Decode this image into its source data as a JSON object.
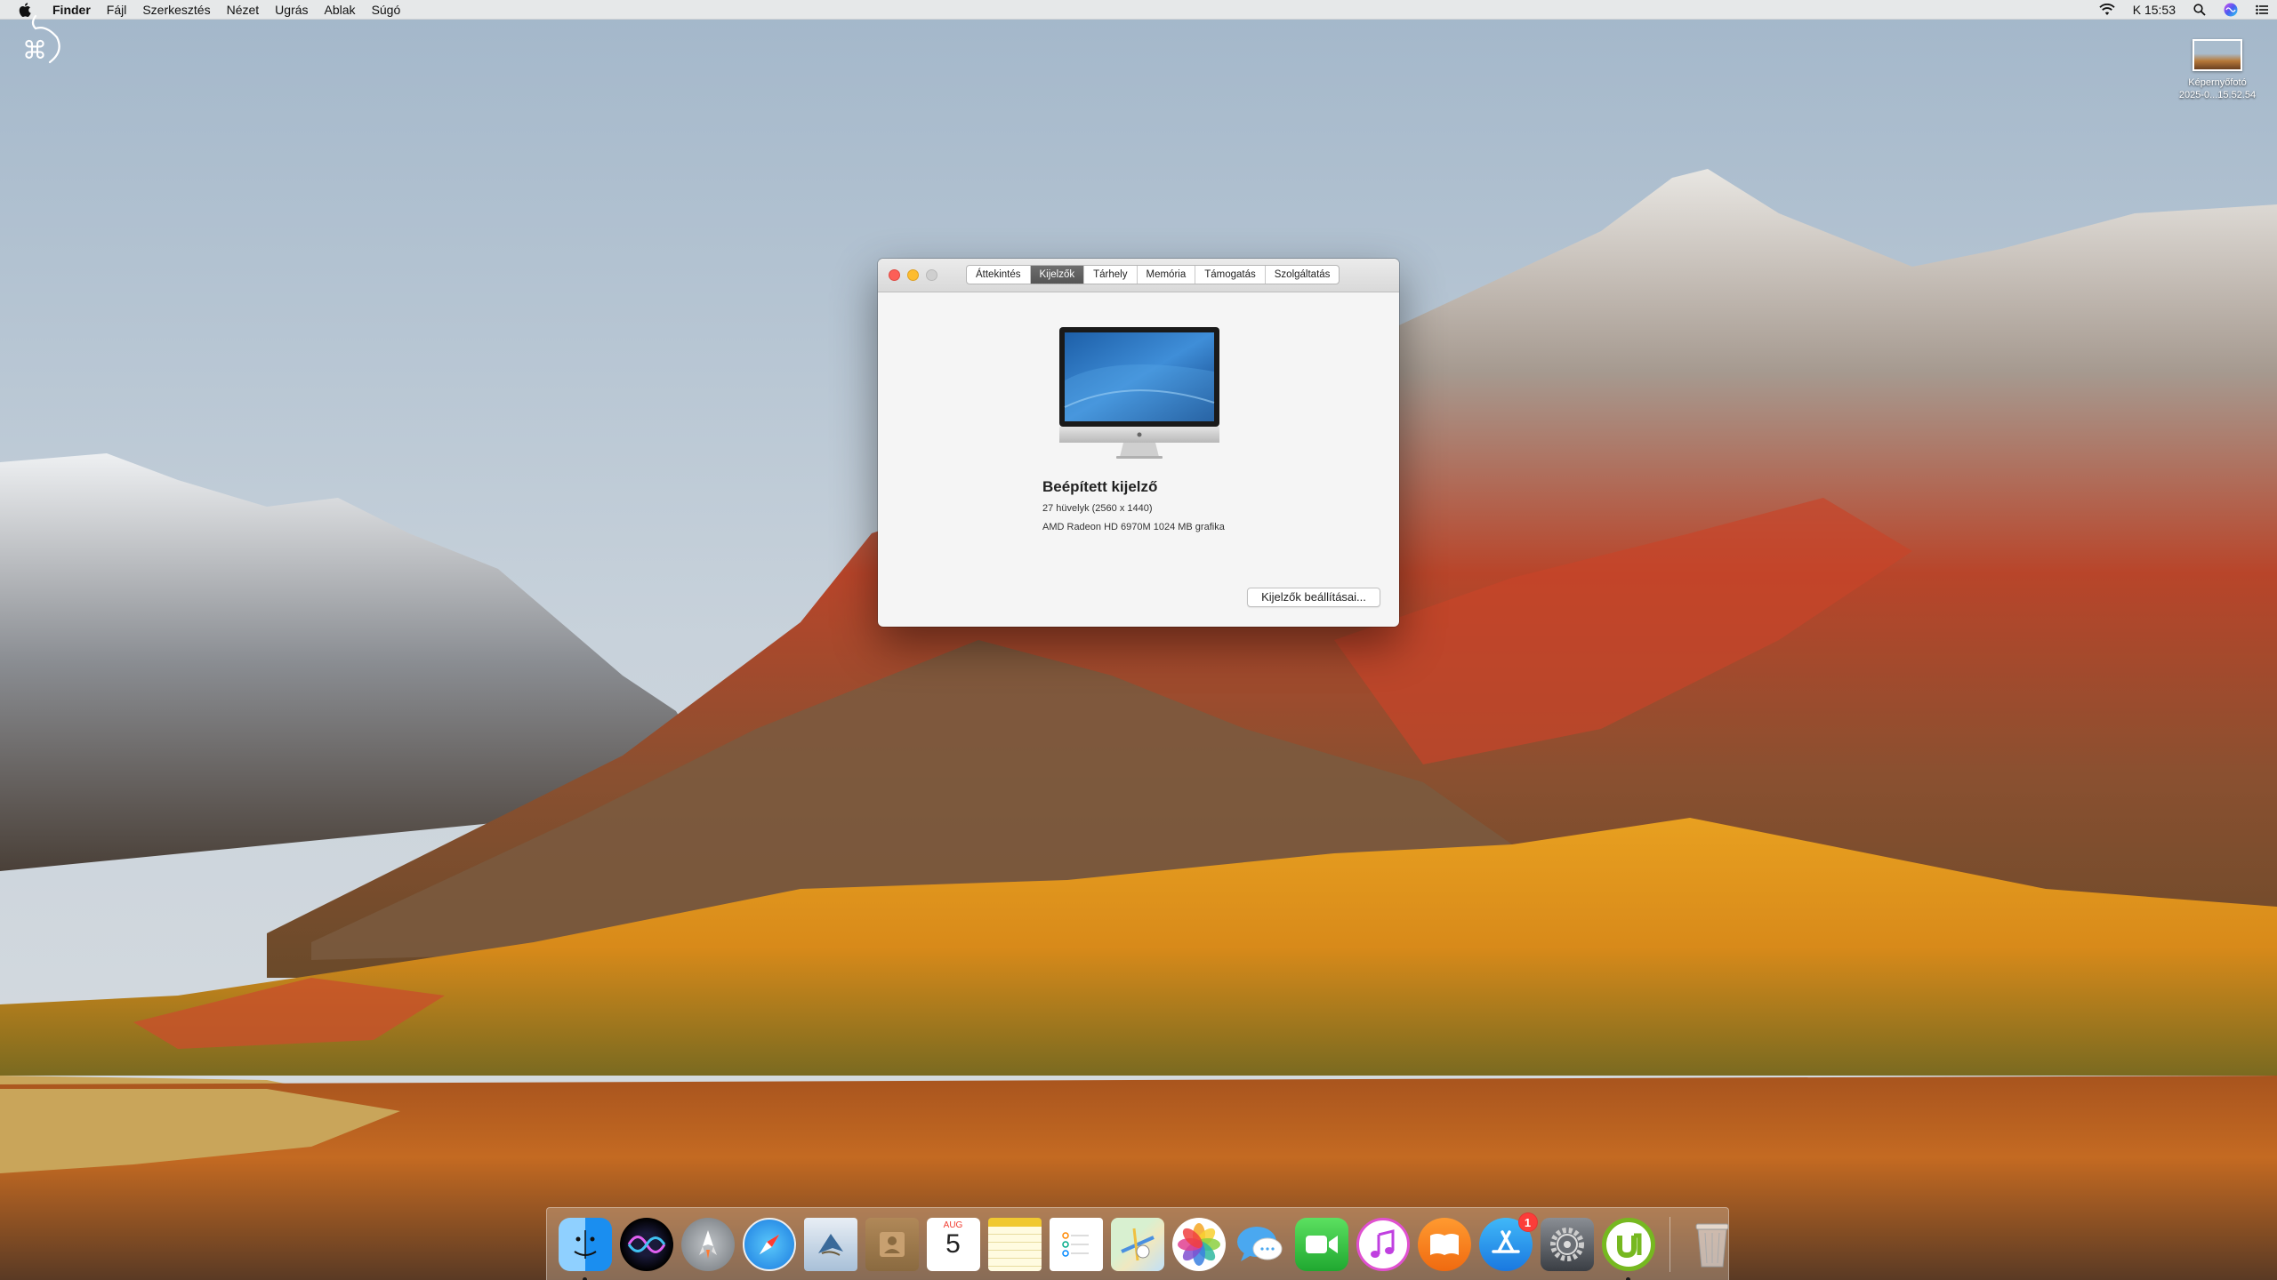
{
  "menubar": {
    "apple_icon": "apple-logo-icon",
    "app_name": "Finder",
    "menus": [
      "Fájl",
      "Szerkesztés",
      "Nézet",
      "Ugrás",
      "Ablak",
      "Súgó"
    ],
    "clock": "K 15:53",
    "status_icons": [
      "wifi-icon",
      "search-icon",
      "siri-icon",
      "notification-center-icon"
    ]
  },
  "desktop": {
    "file_name": "Képernyőfotó",
    "file_subtitle": "2025-0...15.52.54"
  },
  "about_window": {
    "tabs": [
      "Áttekintés",
      "Kijelzők",
      "Tárhely",
      "Memória",
      "Támogatás",
      "Szolgáltatás"
    ],
    "active_tab": "Kijelzők",
    "display_title": "Beépített kijelző",
    "display_size": "27 hüvelyk (2560 x 1440)",
    "graphics": "AMD Radeon HD 6970M 1024 MB grafika",
    "settings_button": "Kijelzők beállításai..."
  },
  "dock": {
    "items": [
      {
        "name": "Finder",
        "icon": "finder-icon",
        "running": true
      },
      {
        "name": "Siri",
        "icon": "siri-icon"
      },
      {
        "name": "Launchpad",
        "icon": "launchpad-icon"
      },
      {
        "name": "Safari",
        "icon": "safari-icon"
      },
      {
        "name": "Mail",
        "icon": "mail-icon"
      },
      {
        "name": "Contacts",
        "icon": "contacts-icon"
      },
      {
        "name": "Calendar",
        "icon": "calendar-icon",
        "month": "AUG",
        "day": "5"
      },
      {
        "name": "Notes",
        "icon": "notes-icon"
      },
      {
        "name": "Reminders",
        "icon": "reminders-icon"
      },
      {
        "name": "Maps",
        "icon": "maps-icon"
      },
      {
        "name": "Photos",
        "icon": "photos-icon"
      },
      {
        "name": "Messages",
        "icon": "messages-icon"
      },
      {
        "name": "FaceTime",
        "icon": "facetime-icon"
      },
      {
        "name": "iTunes",
        "icon": "itunes-icon"
      },
      {
        "name": "iBooks",
        "icon": "ibooks-icon"
      },
      {
        "name": "App Store",
        "icon": "app-store-icon",
        "badge": "1"
      },
      {
        "name": "System Preferences",
        "icon": "system-preferences-icon"
      },
      {
        "name": "uTorrent",
        "icon": "utorrent-icon",
        "running": true
      },
      {
        "name": "Trash",
        "icon": "trash-icon"
      }
    ]
  }
}
